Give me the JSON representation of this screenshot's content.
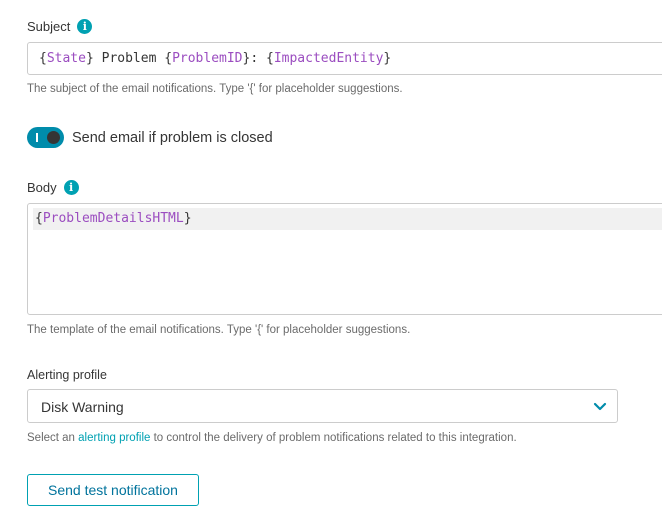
{
  "subject": {
    "label": "Subject",
    "parts": [
      {
        "text": "{",
        "ph": false
      },
      {
        "text": "State",
        "ph": true
      },
      {
        "text": "} Problem {",
        "ph": false
      },
      {
        "text": "ProblemID",
        "ph": true
      },
      {
        "text": "}: {",
        "ph": false
      },
      {
        "text": "ImpactedEntity",
        "ph": true
      },
      {
        "text": "}",
        "ph": false
      }
    ],
    "hint": "The subject of the email notifications. Type '{' for placeholder suggestions."
  },
  "toggle": {
    "label": "Send email if problem is closed",
    "state": "on"
  },
  "body": {
    "label": "Body",
    "parts": [
      {
        "text": "{",
        "ph": false
      },
      {
        "text": "ProblemDetailsHTML",
        "ph": true
      },
      {
        "text": "}",
        "ph": false
      }
    ],
    "hint": "The template of the email notifications. Type '{' for placeholder suggestions."
  },
  "alerting": {
    "label": "Alerting profile",
    "selected": "Disk Warning",
    "hint_prefix": "Select an ",
    "hint_link": "alerting profile",
    "hint_suffix": " to control the delivery of problem notifications related to this integration."
  },
  "actions": {
    "test_button": "Send test notification"
  },
  "colors": {
    "accent": "#00a1b2",
    "toggle_on": "#008cab",
    "placeholder": "#9b4dc0"
  },
  "icons": [
    "info-icon",
    "chevron-down-icon"
  ]
}
